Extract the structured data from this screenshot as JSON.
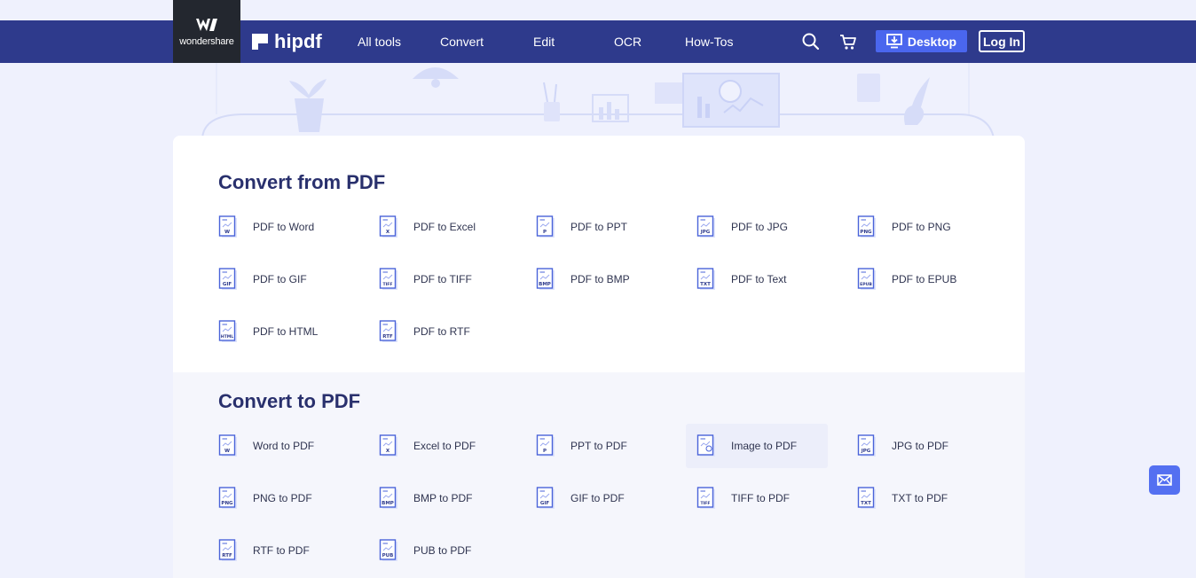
{
  "header": {
    "company": "wondershare",
    "brand": "hipdf",
    "nav": [
      "All tools",
      "Convert",
      "Edit",
      "OCR",
      "How-Tos"
    ],
    "desktop_label": "Desktop",
    "login_label": "Log In",
    "icons": {
      "search": "search-icon",
      "cart": "cart-icon",
      "download": "download-icon"
    }
  },
  "colors": {
    "nav_bg": "#2e3a8c",
    "accent": "#4a66ee",
    "heading": "#29306d"
  },
  "convert_from": {
    "title": "Convert from PDF",
    "tools": [
      {
        "label": "PDF to Word",
        "tag": "W"
      },
      {
        "label": "PDF to Excel",
        "tag": "X"
      },
      {
        "label": "PDF to PPT",
        "tag": "P"
      },
      {
        "label": "PDF to JPG",
        "tag": "JPG"
      },
      {
        "label": "PDF to PNG",
        "tag": "PNG"
      },
      {
        "label": "PDF to GIF",
        "tag": "GIF"
      },
      {
        "label": "PDF to TIFF",
        "tag": "TIFF"
      },
      {
        "label": "PDF to BMP",
        "tag": "BMP"
      },
      {
        "label": "PDF to Text",
        "tag": "TXT"
      },
      {
        "label": "PDF to EPUB",
        "tag": "EPUB"
      },
      {
        "label": "PDF to HTML",
        "tag": "HTML"
      },
      {
        "label": "PDF to RTF",
        "tag": "RTF"
      }
    ]
  },
  "convert_to": {
    "title": "Convert to PDF",
    "tools": [
      {
        "label": "Word to PDF",
        "tag": "W"
      },
      {
        "label": "Excel to PDF",
        "tag": "X"
      },
      {
        "label": "PPT to PDF",
        "tag": "P"
      },
      {
        "label": "Image to PDF",
        "tag": ""
      },
      {
        "label": "JPG to PDF",
        "tag": "JPG"
      },
      {
        "label": "PNG to PDF",
        "tag": "PNG"
      },
      {
        "label": "BMP to PDF",
        "tag": "BMP"
      },
      {
        "label": "GIF to PDF",
        "tag": "GIF"
      },
      {
        "label": "TIFF to PDF",
        "tag": "TIFF"
      },
      {
        "label": "TXT to PDF",
        "tag": "TXT"
      },
      {
        "label": "RTF to PDF",
        "tag": "RTF"
      },
      {
        "label": "PUB to PDF",
        "tag": "PUB"
      }
    ]
  }
}
